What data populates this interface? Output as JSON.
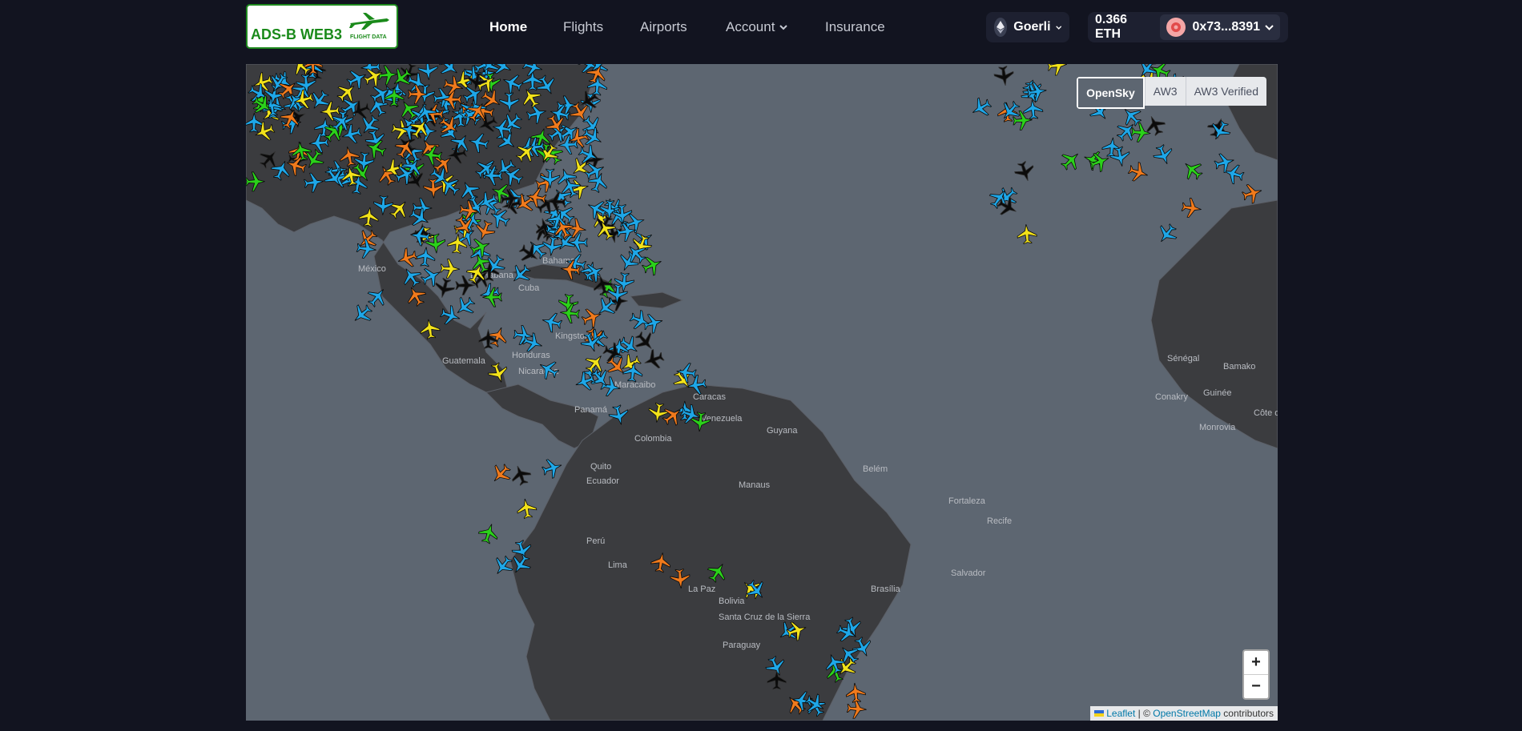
{
  "header": {
    "logo": {
      "brand": "ADS-B WEB3",
      "sub": "FLIGHT DATA"
    },
    "nav": [
      {
        "label": "Home",
        "active": true
      },
      {
        "label": "Flights",
        "active": false
      },
      {
        "label": "Airports",
        "active": false
      },
      {
        "label": "Account",
        "active": false,
        "dropdown": true
      },
      {
        "label": "Insurance",
        "active": false
      }
    ],
    "network": {
      "label": "Goerli",
      "icon": "ethereum-icon"
    },
    "balance": "0.366 ETH",
    "wallet": {
      "address": "0x73...8391",
      "icon": "avatar-icon"
    }
  },
  "map": {
    "layers": [
      {
        "label": "OpenSky",
        "active": true
      },
      {
        "label": "AW3",
        "active": false
      },
      {
        "label": "AW3 Verified",
        "active": false
      }
    ],
    "zoom_in": "+",
    "zoom_out": "−",
    "attribution": {
      "leaflet": "Leaflet",
      "separator": " | © ",
      "osm": "OpenStreetMap",
      "suffix": " contributors"
    },
    "places": [
      "Cuba",
      "La Habana",
      "Bahamas",
      "México",
      "Guatemala",
      "Honduras",
      "Nicaragua",
      "Panamá",
      "Maracaibo",
      "Caracas",
      "Venezuela",
      "Guyana",
      "Colombia",
      "Quito",
      "Ecuador",
      "Perú",
      "Lima",
      "Manaus",
      "Belém",
      "Fortaleza",
      "Recife",
      "Salvador",
      "Brasília",
      "Bolivia",
      "La Paz",
      "Santa Cruz de la Sierra",
      "Paraguay",
      "Sénégal",
      "Bamako",
      "Conakry",
      "Guinée",
      "Monrovia",
      "Côte d'Iv",
      "Kingston"
    ],
    "plane_colors": {
      "blue": "#1ea7e8",
      "green": "#2bd11a",
      "yellow": "#f2e21a",
      "orange": "#f07a1c",
      "black": "#0b0b0b"
    }
  }
}
